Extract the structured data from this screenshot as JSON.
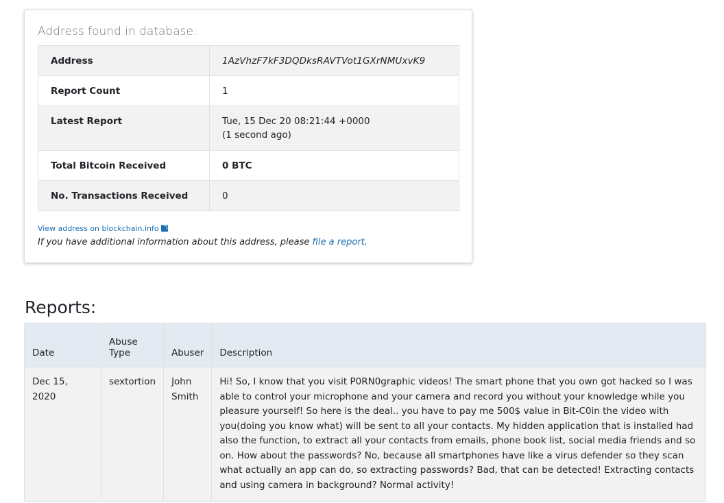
{
  "address_card": {
    "title": "Address found in database:",
    "rows": [
      {
        "key": "Address",
        "value": "1AzVhzF7kF3DQDksRAVTVot1GXrNMUxvK9"
      },
      {
        "key": "Report Count",
        "value": "1"
      },
      {
        "key": "Latest Report",
        "value": "Tue, 15 Dec 20 08:21:44 +0000",
        "sub": "(1 second ago)"
      },
      {
        "key": "Total Bitcoin Received",
        "value": "0 BTC"
      },
      {
        "key": "No. Transactions Received",
        "value": "0"
      }
    ],
    "blockchain_link": "View address on blockchain.info",
    "note_prefix": "If you have additional information about this address, please ",
    "note_link": "file a report",
    "note_suffix": "."
  },
  "reports": {
    "title": "Reports:",
    "columns": {
      "date": "Date",
      "abuse_type": "Abuse Type",
      "abuser": "Abuser",
      "description": "Description"
    },
    "rows": [
      {
        "date": "Dec 15, 2020",
        "abuse_type": "sextortion",
        "abuser": "John Smith",
        "description": "Hi! So, I know that you visit P0RN0graphic videos! The smart phone that you own got hacked so I was able to control your microphone and your camera and record you without your knowledge while you pleasure yourself! So here is the deal.. you have to pay me 500$ value in Bit-C0in the video with you(doing you know what) will be sent to all your contacts. My hidden application that is installed had also the function, to extract all your contacts from emails, phone book list, social media friends and so on. How about the passwords? No, because all smartphones have like a virus defender so they scan what actually an app can do, so extracting passwords? Bad, that can be detected! Extracting contacts and using camera in background? Normal activity!"
      }
    ]
  },
  "colors": {
    "link": "#1a6fb5",
    "row_shade": "#f2f2f2",
    "header_bg": "#e4eaf1"
  }
}
